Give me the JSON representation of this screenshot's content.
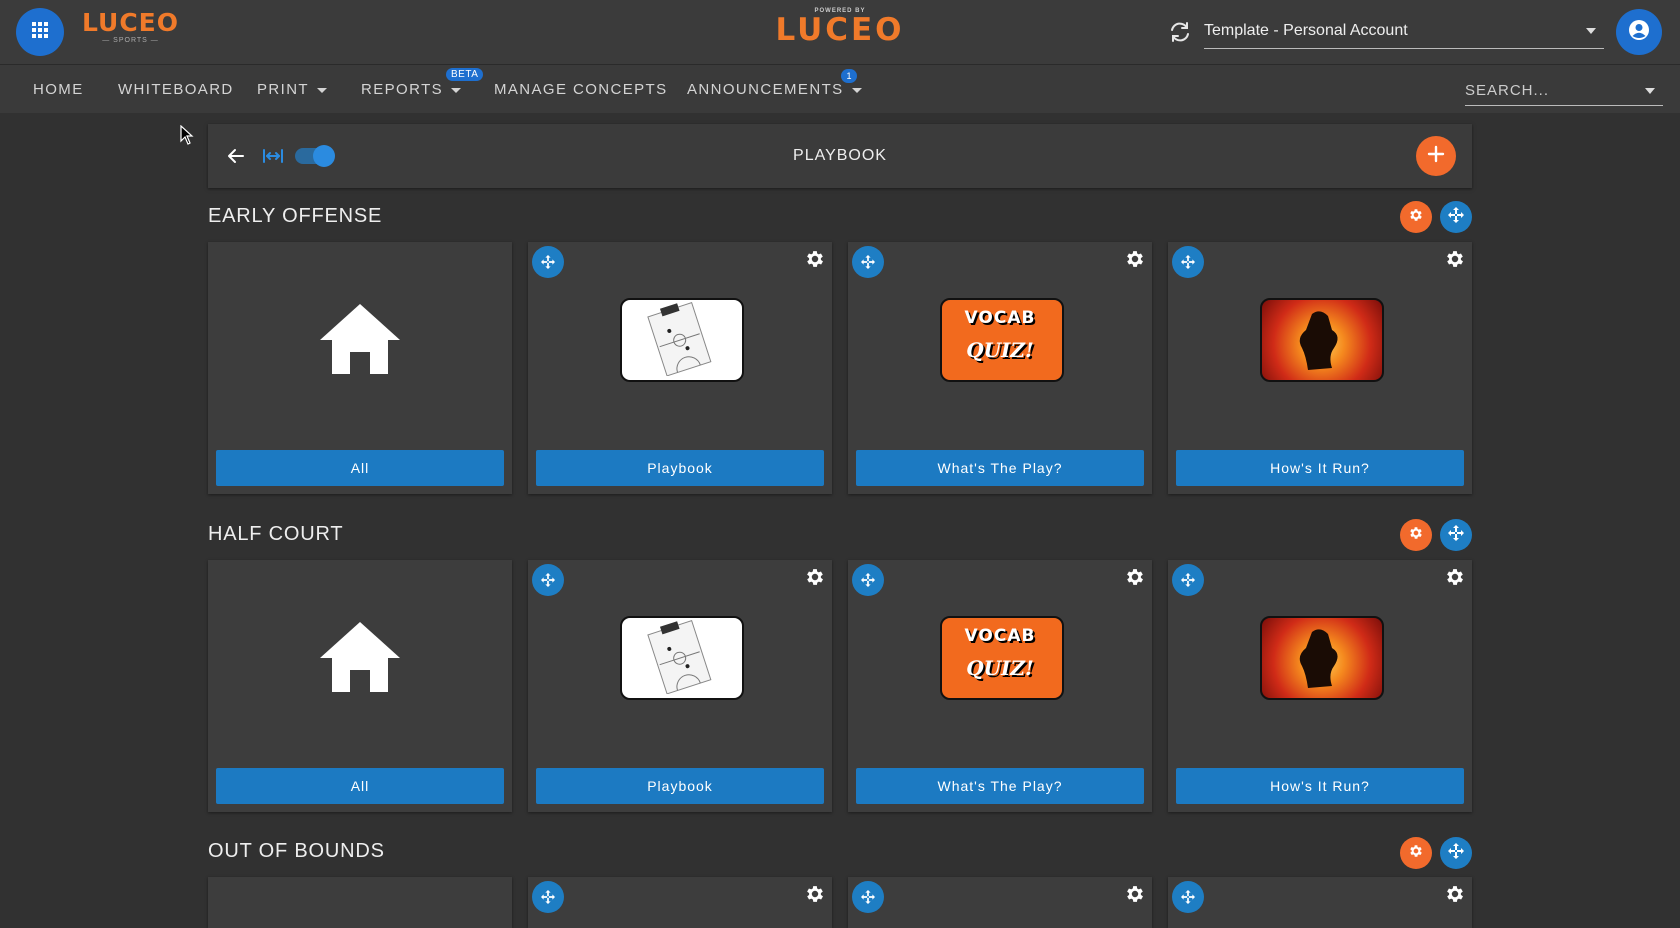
{
  "topbar": {
    "apps_icon": "grid-icon",
    "brand_left": "LUCEO",
    "brand_left_sub": "— SPORTS —",
    "brand_center_powered": "POWERED BY",
    "brand_center": "LUCEO",
    "refresh_icon": "refresh-icon",
    "account_value": "Template - Personal Account",
    "user_icon": "user-circle-icon"
  },
  "nav": {
    "home": "HOME",
    "whiteboard": "WHITEBOARD",
    "print": "PRINT",
    "reports": "REPORTS",
    "reports_badge": "BETA",
    "manage_concepts": "MANAGE CONCEPTS",
    "announcements": "ANNOUNCEMENTS",
    "announcements_badge": "1",
    "search_placeholder": "SEARCH..."
  },
  "header": {
    "title": "PLAYBOOK",
    "toggle_on": true
  },
  "sections": [
    {
      "title": "EARLY OFFENSE",
      "cards": [
        {
          "label": "All",
          "thumb": "home-icon"
        },
        {
          "label": "Playbook",
          "thumb": "playbook-clipboard"
        },
        {
          "label": "What's The Play?",
          "thumb": "vocab-quiz"
        },
        {
          "label": "How's It Run?",
          "thumb": "how-it-runs"
        }
      ]
    },
    {
      "title": "HALF COURT",
      "cards": [
        {
          "label": "All",
          "thumb": "home-icon"
        },
        {
          "label": "Playbook",
          "thumb": "playbook-clipboard"
        },
        {
          "label": "What's The Play?",
          "thumb": "vocab-quiz"
        },
        {
          "label": "How's It Run?",
          "thumb": "how-it-runs"
        }
      ]
    },
    {
      "title": "OUT OF BOUNDS",
      "cards": [
        {
          "label": "",
          "thumb": ""
        },
        {
          "label": "",
          "thumb": ""
        },
        {
          "label": "",
          "thumb": ""
        },
        {
          "label": "",
          "thumb": ""
        }
      ]
    }
  ],
  "thumb_text": {
    "vocab": "VOCAB",
    "quiz": "QUIZ!"
  },
  "colors": {
    "accent_blue": "#1e7ec4",
    "accent_orange": "#f26a2c",
    "brand_orange": "#f07a2a",
    "background": "#313131"
  }
}
